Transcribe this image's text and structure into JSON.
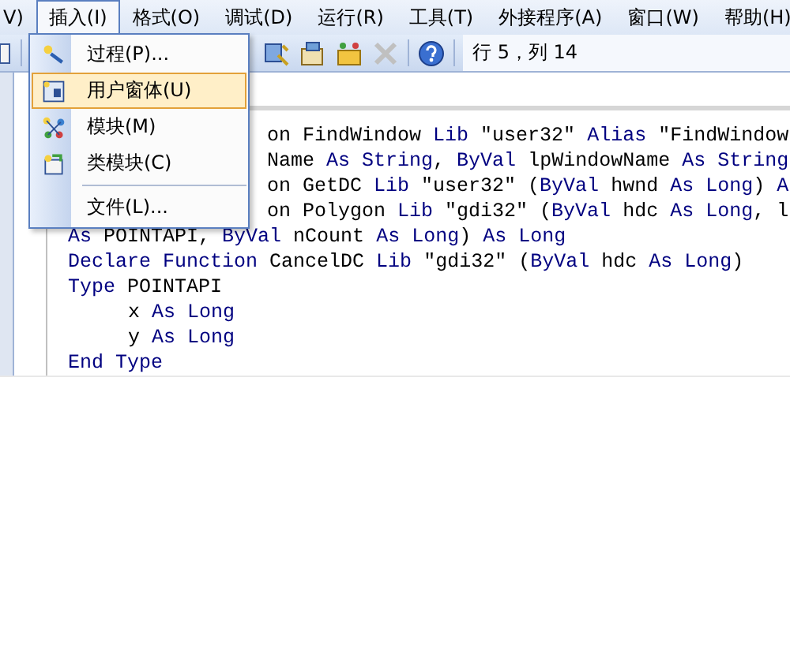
{
  "menu_bar": [
    {
      "label": "V)",
      "selected": false
    },
    {
      "label": "插入(I)",
      "selected": true
    },
    {
      "label": "格式(O)",
      "selected": false
    },
    {
      "label": "调试(D)",
      "selected": false
    },
    {
      "label": "运行(R)",
      "selected": false
    },
    {
      "label": "工具(T)",
      "selected": false
    },
    {
      "label": "外接程序(A)",
      "selected": false
    },
    {
      "label": "窗口(W)",
      "selected": false
    },
    {
      "label": "帮助(H)",
      "selected": false
    }
  ],
  "toolbar": {
    "position": "行 5，列 14"
  },
  "insert_menu": [
    {
      "label": "过程(P)...",
      "selected": false,
      "kind": "item"
    },
    {
      "label": "用户窗体(U)",
      "selected": true,
      "kind": "item"
    },
    {
      "label": "模块(M)",
      "selected": false,
      "kind": "item"
    },
    {
      "label": "类模块(C)",
      "selected": false,
      "kind": "item"
    },
    {
      "label": "文件(L)...",
      "selected": false,
      "kind": "item",
      "separator_before": true
    }
  ],
  "code_lines": [
    {
      "kind": "covered",
      "tokens": [
        {
          "text": "on FindWindow ",
          "kind": "plain"
        },
        {
          "text": "Lib",
          "kind": "keyword"
        },
        {
          "text": " \"user32\" ",
          "kind": "plain"
        },
        {
          "text": "Alias",
          "kind": "keyword"
        },
        {
          "text": " \"FindWindow",
          "kind": "plain"
        }
      ]
    },
    {
      "kind": "covered",
      "tokens": [
        {
          "text": "Name ",
          "kind": "plain"
        },
        {
          "text": "As String",
          "kind": "keyword"
        },
        {
          "text": ", ",
          "kind": "plain"
        },
        {
          "text": "ByVal",
          "kind": "keyword"
        },
        {
          "text": " lpWindowName ",
          "kind": "plain"
        },
        {
          "text": "As String",
          "kind": "keyword"
        }
      ]
    },
    {
      "kind": "covered",
      "tokens": [
        {
          "text": "on GetDC ",
          "kind": "plain"
        },
        {
          "text": "Lib",
          "kind": "keyword"
        },
        {
          "text": " \"user32\" (",
          "kind": "plain"
        },
        {
          "text": "ByVal",
          "kind": "keyword"
        },
        {
          "text": " hwnd ",
          "kind": "plain"
        },
        {
          "text": "As Long",
          "kind": "keyword"
        },
        {
          "text": ") ",
          "kind": "plain"
        },
        {
          "text": "A",
          "kind": "keyword"
        }
      ]
    },
    {
      "kind": "covered",
      "tokens": [
        {
          "text": "on Polygon ",
          "kind": "plain"
        },
        {
          "text": "Lib",
          "kind": "keyword"
        },
        {
          "text": " \"gdi32\" (",
          "kind": "plain"
        },
        {
          "text": "ByVal",
          "kind": "keyword"
        },
        {
          "text": " hdc ",
          "kind": "plain"
        },
        {
          "text": "As Long",
          "kind": "keyword"
        },
        {
          "text": ", l",
          "kind": "plain"
        }
      ]
    },
    {
      "kind": "plain",
      "tokens": [
        {
          "text": "As",
          "kind": "keyword"
        },
        {
          "text": " POINTAPI, ",
          "kind": "plain"
        },
        {
          "text": "ByVal",
          "kind": "keyword"
        },
        {
          "text": " nCount ",
          "kind": "plain"
        },
        {
          "text": "As Long",
          "kind": "keyword"
        },
        {
          "text": ") ",
          "kind": "plain"
        },
        {
          "text": "As Long",
          "kind": "keyword"
        }
      ]
    },
    {
      "kind": "plain",
      "tokens": [
        {
          "text": "Declare Function",
          "kind": "keyword"
        },
        {
          "text": " CancelDC ",
          "kind": "plain"
        },
        {
          "text": "Lib",
          "kind": "keyword"
        },
        {
          "text": " \"gdi32\" (",
          "kind": "plain"
        },
        {
          "text": "ByVal",
          "kind": "keyword"
        },
        {
          "text": " hdc ",
          "kind": "plain"
        },
        {
          "text": "As Long",
          "kind": "keyword"
        },
        {
          "text": ")",
          "kind": "plain"
        }
      ]
    },
    {
      "kind": "plain",
      "tokens": [
        {
          "text": "Type",
          "kind": "keyword"
        },
        {
          "text": " POINTAPI",
          "kind": "plain"
        }
      ]
    },
    {
      "kind": "indented",
      "tokens": [
        {
          "text": "x ",
          "kind": "plain"
        },
        {
          "text": "As Long",
          "kind": "keyword"
        }
      ]
    },
    {
      "kind": "indented",
      "tokens": [
        {
          "text": "y ",
          "kind": "plain"
        },
        {
          "text": "As Long",
          "kind": "keyword"
        }
      ]
    },
    {
      "kind": "plain",
      "tokens": [
        {
          "text": "End Type",
          "kind": "keyword"
        }
      ]
    }
  ]
}
